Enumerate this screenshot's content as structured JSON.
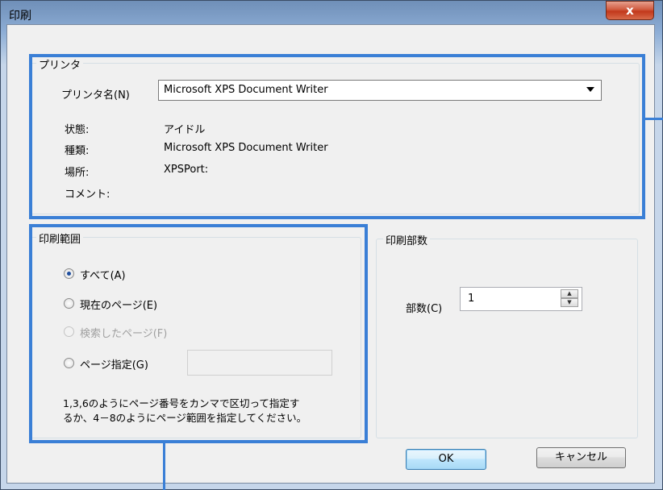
{
  "window": {
    "title": "印刷",
    "close_label": "x"
  },
  "printer": {
    "group_title": "プリンタ",
    "name_label": "プリンタ名(N)",
    "selected_printer": "Microsoft XPS Document Writer",
    "status_label": "状態:",
    "status_value": "アイドル",
    "type_label": "種類:",
    "type_value": "Microsoft XPS Document Writer",
    "location_label": "場所:",
    "location_value": "XPSPort:",
    "comment_label": "コメント:",
    "comment_value": ""
  },
  "print_range": {
    "group_title": "印刷範囲",
    "options": [
      {
        "label": "すべて(A)",
        "checked": true,
        "enabled": true
      },
      {
        "label": "現在のページ(E)",
        "checked": false,
        "enabled": true
      },
      {
        "label": "検索したページ(F)",
        "checked": false,
        "enabled": false
      },
      {
        "label": "ページ指定(G)",
        "checked": false,
        "enabled": true
      }
    ],
    "pages_input_value": "",
    "hint_line1": "1,3,6のようにページ番号をカンマで区切って指定す",
    "hint_line2": "るか、4－8のようにページ範囲を指定してください。"
  },
  "copies": {
    "group_title": "印刷部数",
    "count_label": "部数(C)",
    "count_value": "1"
  },
  "buttons": {
    "ok": "OK",
    "cancel": "キャンセル"
  },
  "colors": {
    "highlight": "#3a7fd6",
    "dialog_bg": "#f0f0f0"
  }
}
